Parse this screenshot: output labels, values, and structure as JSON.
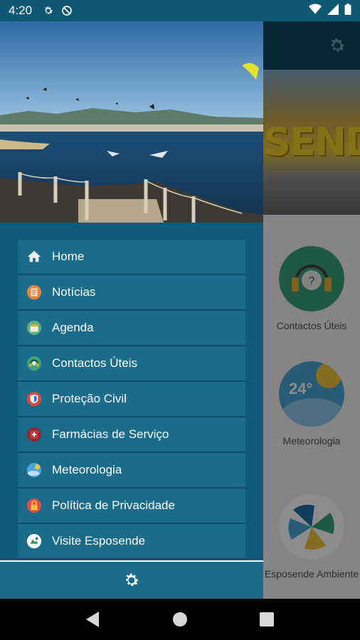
{
  "status_bar": {
    "time": "4:20",
    "icons": [
      "gear-icon",
      "no-disturb-icon",
      "wifi-icon",
      "signal-icon",
      "battery-icon"
    ]
  },
  "drawer": {
    "menu": [
      {
        "label": "Home",
        "icon": "home-icon",
        "color": "#e9eef2"
      },
      {
        "label": "Notícias",
        "icon": "news-icon",
        "color": "#e8843a"
      },
      {
        "label": "Agenda",
        "icon": "calendar-icon",
        "color": "#5fb08a"
      },
      {
        "label": "Contactos Úteis",
        "icon": "headset-icon",
        "color": "#3aa37a"
      },
      {
        "label": "Proteção Civil",
        "icon": "shield-icon",
        "color": "#d9493a"
      },
      {
        "label": "Farmácias de Serviço",
        "icon": "pharmacy-icon",
        "color": "#c6373a"
      },
      {
        "label": "Meteorologia",
        "icon": "weather-icon",
        "color": "#4aa6d8"
      },
      {
        "label": "Política de Privacidade",
        "icon": "lock-icon",
        "color": "#e0504a"
      },
      {
        "label": "Visite Esposende",
        "icon": "visit-icon",
        "color": "#ffffff"
      }
    ],
    "footer_icon": "settings-icon"
  },
  "background": {
    "banner_text": "SENDE",
    "tiles": [
      {
        "label": "Contactos Úteis"
      },
      {
        "label": "Meteorologia",
        "temp": "24°"
      },
      {
        "label": "Esposende Ambiente"
      }
    ]
  },
  "nav_bar": {
    "icons": [
      "back-icon",
      "home-circle-icon",
      "recents-icon"
    ]
  }
}
